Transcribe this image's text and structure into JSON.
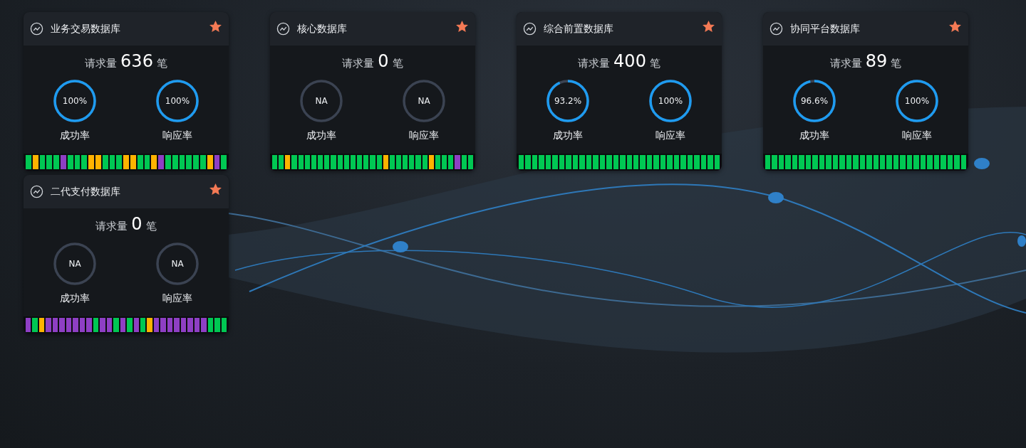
{
  "cards": [
    {
      "title": "业务交易数据库",
      "favorite": true,
      "request_label": "请求量",
      "request_count": "636",
      "request_unit": "笔",
      "gauges": [
        {
          "value": "100%",
          "level": 1,
          "label": "成功率"
        },
        {
          "value": "100%",
          "level": 1,
          "label": "响应率"
        }
      ],
      "bars": [
        {
          "color": "#00c853"
        },
        {
          "color": "#ffb300"
        },
        {
          "color": "#00c853"
        },
        {
          "color": "#00c853"
        },
        {
          "color": "#00c853"
        },
        {
          "color": "#8e3fc4"
        },
        {
          "color": "#00c853"
        },
        {
          "color": "#00c853"
        },
        {
          "color": "#00c853"
        },
        {
          "color": "#ffb300"
        },
        {
          "color": "#ffb300"
        },
        {
          "color": "#00c853"
        },
        {
          "color": "#00c853"
        },
        {
          "color": "#00c853"
        },
        {
          "color": "#ffb300"
        },
        {
          "color": "#ffb300"
        },
        {
          "color": "#00c853"
        },
        {
          "color": "#00c853"
        },
        {
          "color": "#ffb300"
        },
        {
          "color": "#8e3fc4"
        },
        {
          "color": "#00c853"
        },
        {
          "color": "#00c853"
        },
        {
          "color": "#00c853"
        },
        {
          "color": "#00c853"
        },
        {
          "color": "#00c853"
        },
        {
          "color": "#00c853"
        },
        {
          "color": "#ffb300"
        },
        {
          "color": "#8e3fc4"
        },
        {
          "color": "#00c853"
        }
      ]
    },
    {
      "title": "核心数据库",
      "favorite": true,
      "request_label": "请求量",
      "request_count": "0",
      "request_unit": "笔",
      "gauges": [
        {
          "value": "NA",
          "label": "成功率"
        },
        {
          "value": "NA",
          "label": "响应率"
        }
      ],
      "bars": [
        {
          "color": "#00c853"
        },
        {
          "color": "#00c853"
        },
        {
          "color": "#ffb300"
        },
        {
          "color": "#00c853"
        },
        {
          "color": "#00c853"
        },
        {
          "color": "#00c853"
        },
        {
          "color": "#00c853"
        },
        {
          "color": "#00c853"
        },
        {
          "color": "#00c853"
        },
        {
          "color": "#00c853"
        },
        {
          "color": "#00c853"
        },
        {
          "color": "#00c853"
        },
        {
          "color": "#00c853"
        },
        {
          "color": "#00c853"
        },
        {
          "color": "#00c853"
        },
        {
          "color": "#00c853"
        },
        {
          "color": "#00c853"
        },
        {
          "color": "#ffb300"
        },
        {
          "color": "#00c853"
        },
        {
          "color": "#00c853"
        },
        {
          "color": "#00c853"
        },
        {
          "color": "#00c853"
        },
        {
          "color": "#00c853"
        },
        {
          "color": "#00c853"
        },
        {
          "color": "#ffb300"
        },
        {
          "color": "#00c853"
        },
        {
          "color": "#00c853"
        },
        {
          "color": "#00c853"
        },
        {
          "color": "#8e3fc4"
        },
        {
          "color": "#00c853"
        },
        {
          "color": "#00c853"
        }
      ]
    },
    {
      "title": "综合前置数据库",
      "favorite": true,
      "request_label": "请求量",
      "request_count": "400",
      "request_unit": "笔",
      "gauges": [
        {
          "value": "93.2%",
          "level": 0.932,
          "label": "成功率"
        },
        {
          "value": "100%",
          "level": 1,
          "label": "响应率"
        }
      ],
      "bars": [
        {
          "color": "#00c853"
        },
        {
          "color": "#00c853"
        },
        {
          "color": "#00c853"
        },
        {
          "color": "#00c853"
        },
        {
          "color": "#00c853"
        },
        {
          "color": "#00c853"
        },
        {
          "color": "#00c853"
        },
        {
          "color": "#00c853"
        },
        {
          "color": "#00c853"
        },
        {
          "color": "#00c853"
        },
        {
          "color": "#00c853"
        },
        {
          "color": "#00c853"
        },
        {
          "color": "#00c853"
        },
        {
          "color": "#00c853"
        },
        {
          "color": "#00c853"
        },
        {
          "color": "#00c853"
        },
        {
          "color": "#00c853"
        },
        {
          "color": "#00c853"
        },
        {
          "color": "#00c853"
        },
        {
          "color": "#00c853"
        },
        {
          "color": "#00c853"
        },
        {
          "color": "#00c853"
        },
        {
          "color": "#00c853"
        },
        {
          "color": "#00c853"
        },
        {
          "color": "#00c853"
        },
        {
          "color": "#00c853"
        },
        {
          "color": "#00c853"
        },
        {
          "color": "#00c853"
        },
        {
          "color": "#00c853"
        },
        {
          "color": "#00c853"
        }
      ]
    },
    {
      "title": "协同平台数据库",
      "favorite": true,
      "request_label": "请求量",
      "request_count": "89",
      "request_unit": "笔",
      "gauges": [
        {
          "value": "96.6%",
          "level": 0.966,
          "label": "成功率"
        },
        {
          "value": "100%",
          "level": 1,
          "label": "响应率"
        }
      ],
      "bars": [
        {
          "color": "#00c853"
        },
        {
          "color": "#00c853"
        },
        {
          "color": "#00c853"
        },
        {
          "color": "#00c853"
        },
        {
          "color": "#00c853"
        },
        {
          "color": "#00c853"
        },
        {
          "color": "#00c853"
        },
        {
          "color": "#00c853"
        },
        {
          "color": "#00c853"
        },
        {
          "color": "#00c853"
        },
        {
          "color": "#00c853"
        },
        {
          "color": "#00c853"
        },
        {
          "color": "#00c853"
        },
        {
          "color": "#00c853"
        },
        {
          "color": "#00c853"
        },
        {
          "color": "#00c853"
        },
        {
          "color": "#00c853"
        },
        {
          "color": "#00c853"
        },
        {
          "color": "#00c853"
        },
        {
          "color": "#00c853"
        },
        {
          "color": "#00c853"
        },
        {
          "color": "#00c853"
        },
        {
          "color": "#00c853"
        },
        {
          "color": "#00c853"
        },
        {
          "color": "#00c853"
        },
        {
          "color": "#00c853"
        },
        {
          "color": "#00c853"
        },
        {
          "color": "#00c853"
        },
        {
          "color": "#00c853"
        },
        {
          "color": "#00c853"
        }
      ]
    },
    {
      "title": "二代支付数据库",
      "favorite": true,
      "request_label": "请求量",
      "request_count": "0",
      "request_unit": "笔",
      "gauges": [
        {
          "value": "NA",
          "label": "成功率"
        },
        {
          "value": "NA",
          "label": "响应率"
        }
      ],
      "bars": [
        {
          "color": "#8e3fc4"
        },
        {
          "color": "#00c853"
        },
        {
          "color": "#ffb300"
        },
        {
          "color": "#8e3fc4"
        },
        {
          "color": "#8e3fc4"
        },
        {
          "color": "#8e3fc4"
        },
        {
          "color": "#8e3fc4"
        },
        {
          "color": "#8e3fc4"
        },
        {
          "color": "#8e3fc4"
        },
        {
          "color": "#8e3fc4"
        },
        {
          "color": "#00c853"
        },
        {
          "color": "#8e3fc4"
        },
        {
          "color": "#8e3fc4"
        },
        {
          "color": "#00c853"
        },
        {
          "color": "#8e3fc4"
        },
        {
          "color": "#00c853"
        },
        {
          "color": "#8e3fc4"
        },
        {
          "color": "#00c853"
        },
        {
          "color": "#ffb300"
        },
        {
          "color": "#8e3fc4"
        },
        {
          "color": "#8e3fc4"
        },
        {
          "color": "#8e3fc4"
        },
        {
          "color": "#8e3fc4"
        },
        {
          "color": "#8e3fc4"
        },
        {
          "color": "#8e3fc4"
        },
        {
          "color": "#8e3fc4"
        },
        {
          "color": "#8e3fc4"
        },
        {
          "color": "#00c853"
        },
        {
          "color": "#00c853"
        },
        {
          "color": "#00c853"
        }
      ]
    }
  ]
}
